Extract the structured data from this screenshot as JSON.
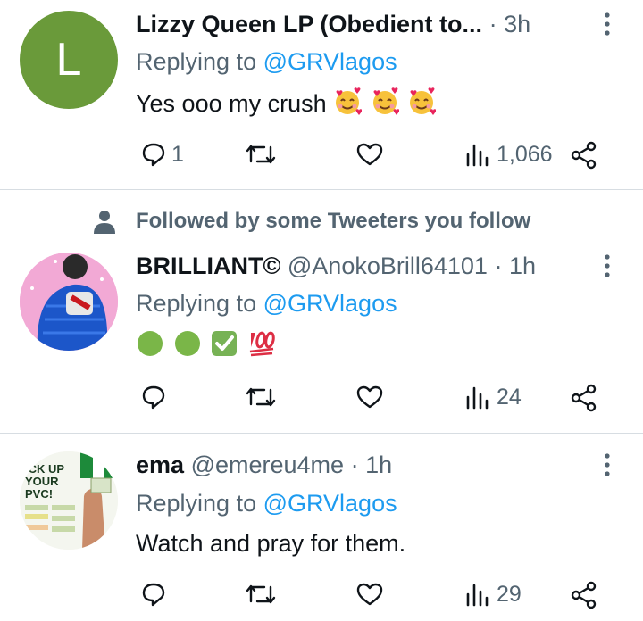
{
  "tweets": [
    {
      "author_name": "Lizzy Queen LP (Obedient to...",
      "author_handle": "",
      "separator": "·",
      "time": "3h",
      "replying_label": "Replying to",
      "replying_handle": "@GRVlagos",
      "text": "Yes ooo my crush",
      "avatar_letter": "L",
      "avatar_color": "#6a9a3a",
      "emojis": [
        "smiling-face-with-hearts",
        "smiling-face-with-hearts",
        "smiling-face-with-hearts"
      ],
      "reply_count": "1",
      "retweet_count": "",
      "like_count": "",
      "view_count": "1,066"
    },
    {
      "social_context": "Followed by some Tweeters you follow",
      "author_name": "BRILLIANT©",
      "author_handle": "@AnokoBrill64101",
      "separator": "·",
      "time": "1h",
      "replying_label": "Replying to",
      "replying_handle": "@GRVlagos",
      "text": "",
      "emojis": [
        "green-circle",
        "green-circle",
        "check-mark-button",
        "hundred-points"
      ],
      "reply_count": "",
      "retweet_count": "",
      "like_count": "",
      "view_count": "24"
    },
    {
      "author_name": "ema",
      "author_handle": "@emereu4me",
      "separator": "·",
      "time": "1h",
      "replying_label": "Replying to",
      "replying_handle": "@GRVlagos",
      "text": "Watch and pray for them.",
      "avatar_text": [
        "ICK UP",
        "YOUR",
        "PVC!"
      ],
      "reply_count": "",
      "retweet_count": "",
      "like_count": "",
      "view_count": "29"
    }
  ],
  "colors": {
    "link_blue": "#1d9bf0",
    "muted_gray": "#536471",
    "divider": "#d7dde2"
  }
}
